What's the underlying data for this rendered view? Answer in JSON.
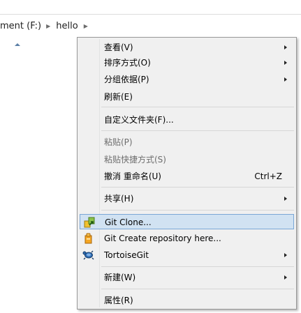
{
  "breadcrumb": {
    "drive": "ment (F:)",
    "folder": "hello"
  },
  "context_menu": {
    "view": "查看(V)",
    "sort_by": "排序方式(O)",
    "group_by": "分组依据(P)",
    "refresh": "刷新(E)",
    "customize_folder": "自定义文件夹(F)...",
    "paste": "粘贴(P)",
    "paste_shortcut": "粘贴快捷方式(S)",
    "undo_rename": "撤消 重命名(U)",
    "undo_shortcut": "Ctrl+Z",
    "share": "共享(H)",
    "git_clone": "Git Clone...",
    "git_create_repo": "Git Create repository here...",
    "tortoisegit": "TortoiseGit",
    "new": "新建(W)",
    "properties": "属性(R)"
  }
}
